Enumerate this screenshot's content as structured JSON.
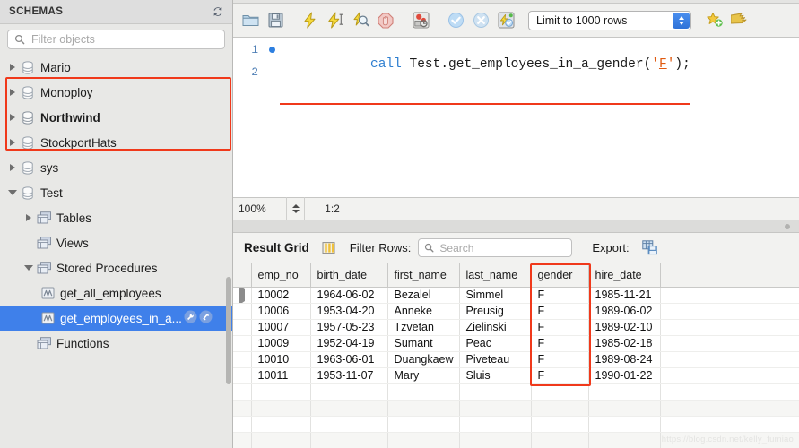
{
  "sidebar": {
    "header_title": "SCHEMAS",
    "refresh_icon": "refresh-icon",
    "filter_placeholder": "Filter objects",
    "filter_value": "",
    "search_icon": "search-icon",
    "tree": [
      {
        "label": "Mario",
        "icon": "database-icon",
        "level": 1,
        "arrow": "collapsed",
        "bold": false,
        "selected": false
      },
      {
        "label": "Monoploy",
        "icon": "database-icon",
        "level": 1,
        "arrow": "collapsed",
        "bold": false,
        "selected": false
      },
      {
        "label": "Northwind",
        "icon": "database-icon",
        "level": 1,
        "arrow": "collapsed",
        "bold": true,
        "selected": false
      },
      {
        "label": "StockportHats",
        "icon": "database-icon",
        "level": 1,
        "arrow": "collapsed",
        "bold": false,
        "selected": false
      },
      {
        "label": "sys",
        "icon": "database-icon",
        "level": 1,
        "arrow": "collapsed",
        "bold": false,
        "selected": false
      },
      {
        "label": "Test",
        "icon": "database-icon",
        "level": 1,
        "arrow": "expanded",
        "bold": false,
        "selected": false
      },
      {
        "label": "Tables",
        "icon": "tables-icon",
        "level": 2,
        "arrow": "collapsed",
        "bold": false,
        "selected": false
      },
      {
        "label": "Views",
        "icon": "tables-icon",
        "level": 2,
        "arrow": "none",
        "bold": false,
        "selected": false
      },
      {
        "label": "Stored Procedures",
        "icon": "tables-icon",
        "level": 2,
        "arrow": "expanded",
        "bold": false,
        "selected": false
      },
      {
        "label": "get_all_employees",
        "icon": "routine-icon",
        "level": 3,
        "arrow": "none",
        "bold": false,
        "selected": false
      },
      {
        "label": "get_employees_in_a...",
        "icon": "routine-icon",
        "level": 3,
        "arrow": "none",
        "bold": false,
        "selected": true
      },
      {
        "label": "Functions",
        "icon": "tables-icon",
        "level": 2,
        "arrow": "none",
        "bold": false,
        "selected": false
      }
    ]
  },
  "toolbar": {
    "buttons": [
      {
        "name": "open-sql-file-icon",
        "title": "Open SQL Script"
      },
      {
        "name": "save-sql-file-icon",
        "title": "Save SQL Script"
      },
      {
        "name": "execute-statement-icon",
        "title": "Execute"
      },
      {
        "name": "execute-current-icon",
        "title": "Execute Current Statement"
      },
      {
        "name": "explain-query-icon",
        "title": "Explain"
      },
      {
        "name": "stop-query-icon",
        "title": "Stop"
      },
      {
        "name": "toggle-stop-on-error-icon",
        "title": "Stop on Error"
      },
      {
        "name": "commit-icon",
        "title": "Commit"
      },
      {
        "name": "rollback-icon",
        "title": "Rollback"
      },
      {
        "name": "autocommit-icon",
        "title": "Toggle Autocommit"
      }
    ],
    "limit_value": "Limit to 1000 rows",
    "favorite_icon": "add-favorite-icon",
    "beautify_icon": "beautify-sql-icon"
  },
  "editor": {
    "lines": [
      {
        "number": "1",
        "has_marker": true,
        "keyword": "call",
        "statement": "Test.get_employees_in_a_gender(",
        "quote_open": "'",
        "param": "F",
        "quote_close": "'",
        "tail": ");"
      },
      {
        "number": "2",
        "has_marker": false,
        "keyword": "",
        "statement": "",
        "quote_open": "",
        "param": "",
        "quote_close": "",
        "tail": ""
      }
    ]
  },
  "status": {
    "zoom": "100%",
    "ratio": "1:2"
  },
  "result_toolbar": {
    "title": "Result Grid",
    "grid_icon": "grid-view-icon",
    "filter_label": "Filter Rows:",
    "filter_placeholder": "Search",
    "filter_value": "",
    "search_icon": "search-icon",
    "export_label": "Export:",
    "export_icon": "export-recordset-icon"
  },
  "result_grid": {
    "columns": [
      "emp_no",
      "birth_date",
      "first_name",
      "last_name",
      "gender",
      "hire_date"
    ],
    "rows": [
      {
        "emp_no": "10002",
        "birth_date": "1964-06-02",
        "first_name": "Bezalel",
        "last_name": "Simmel",
        "gender": "F",
        "hire_date": "1985-11-21"
      },
      {
        "emp_no": "10006",
        "birth_date": "1953-04-20",
        "first_name": "Anneke",
        "last_name": "Preusig",
        "gender": "F",
        "hire_date": "1989-06-02"
      },
      {
        "emp_no": "10007",
        "birth_date": "1957-05-23",
        "first_name": "Tzvetan",
        "last_name": "Zielinski",
        "gender": "F",
        "hire_date": "1989-02-10"
      },
      {
        "emp_no": "10009",
        "birth_date": "1952-04-19",
        "first_name": "Sumant",
        "last_name": "Peac",
        "gender": "F",
        "hire_date": "1985-02-18"
      },
      {
        "emp_no": "10010",
        "birth_date": "1963-06-01",
        "first_name": "Duangkaew",
        "last_name": "Piveteau",
        "gender": "F",
        "hire_date": "1989-08-24"
      },
      {
        "emp_no": "10011",
        "birth_date": "1953-11-07",
        "first_name": "Mary",
        "last_name": "Sluis",
        "gender": "F",
        "hire_date": "1990-01-22"
      }
    ],
    "empty_row_count": 4,
    "active_row_index": 0
  },
  "annotations": {
    "color": "#f0391b",
    "highlight_sql_underline": true,
    "highlight_stored_procedures": true,
    "highlight_gender_column": true
  },
  "watermark": "https://blog.csdn.net/kelly_fumiao"
}
